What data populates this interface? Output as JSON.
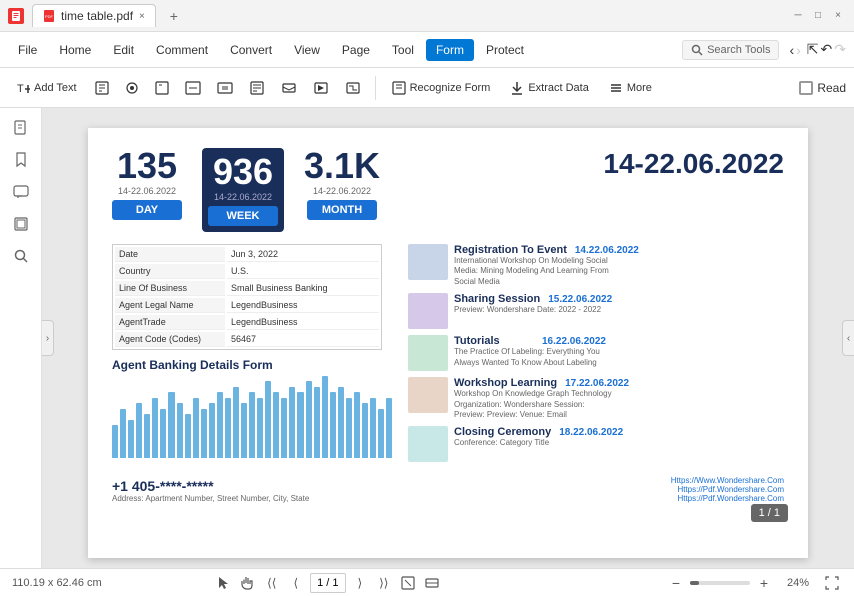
{
  "titlebar": {
    "filename": "time table.pdf",
    "close_label": "×",
    "new_tab_label": "+",
    "min_label": "─",
    "max_label": "□",
    "winclose_label": "×"
  },
  "menubar": {
    "items": [
      "File",
      "Home",
      "Edit",
      "Comment",
      "Convert",
      "View",
      "Page",
      "Tool",
      "Form",
      "Protect"
    ],
    "active": "Form",
    "search_placeholder": "Search Tools",
    "nav_back": "‹",
    "nav_fwd": "›"
  },
  "toolbar": {
    "add_text": "Add Text",
    "recognize_form": "Recognize Form",
    "extract_data": "Extract Data",
    "more": "More",
    "read": "Read"
  },
  "stats": {
    "num1": "135",
    "num2": "936",
    "num3": "3.1K",
    "date_range": "14-22.06.2022",
    "date1": "14-22.06.2022",
    "date2": "14-22.06.2022",
    "date3": "14-22.06.2022",
    "btn_day": "DAY",
    "btn_week": "WEEK",
    "btn_month": "MONTH"
  },
  "form_table": {
    "rows": [
      [
        "Date",
        "Jun 3, 2022"
      ],
      [
        "Country",
        "U.S."
      ],
      [
        "Line Of Business",
        "Small Business Banking"
      ],
      [
        "Agent Legal Name",
        "LegendBusiness"
      ],
      [
        "AgentTrade",
        "LegendBusiness"
      ],
      [
        "Agent Code (Codes)",
        "56467"
      ]
    ]
  },
  "chart": {
    "title": "Agent Banking Details Form",
    "bars": [
      30,
      45,
      35,
      50,
      40,
      55,
      45,
      60,
      50,
      40,
      55,
      45,
      50,
      60,
      55,
      65,
      50,
      60,
      55,
      70,
      60,
      55,
      65,
      60,
      70,
      65,
      75,
      60,
      65,
      55,
      60,
      50,
      55,
      45,
      55
    ]
  },
  "schedule": {
    "items": [
      {
        "title": "Registration To Event",
        "date": "14.22.06.2022",
        "desc": "International Workshop On Modeling Social Media: Mining Modeling And Learning From Social Media"
      },
      {
        "title": "Sharing Session",
        "date": "15.22.06.2022",
        "desc": "Preview: Wondershare\nDate: 2022 - 2022"
      },
      {
        "title": "Tutorials",
        "date": "16.22.06.2022",
        "desc": "The Practice Of Labeling: Everything You Always Wanted To Know About Labeling"
      },
      {
        "title": "Workshop Learning",
        "date": "17.22.06.2022",
        "desc": "Workshop On Knowledge Graph Technology\nOrganization: Wondershare\nSession: Preview: Preview: Venue: Email"
      },
      {
        "title": "Closing Ceremony",
        "date": "18.22.06.2022",
        "desc": "Conference: Category Title"
      }
    ]
  },
  "footer": {
    "phone": "+1 405-****-*****",
    "address": "Address: Apartment Number, Street Number, City, State",
    "websites": "Https://Www.Wondershare.Com\nHttps://Pdf.Wondershare.Com\nHttps://Pdf.Wondershare.Com"
  },
  "statusbar": {
    "dimensions": "110.19 x 62.46 cm",
    "page_current": "1 / 1",
    "nav_first": "⟨⟨",
    "nav_prev": "⟨",
    "nav_next": "⟩",
    "nav_last": "⟩⟩",
    "zoom_out": "−",
    "zoom_in": "+",
    "zoom_level": "24%",
    "page_badge": "1 / 1"
  },
  "icons": {
    "file": "📄",
    "bookmark": "🔖",
    "thumbs": "▦",
    "comment": "💬",
    "layers": "⧉",
    "search": "🔍",
    "cursor": "↖",
    "hand": "✋",
    "expand": "⛶"
  }
}
